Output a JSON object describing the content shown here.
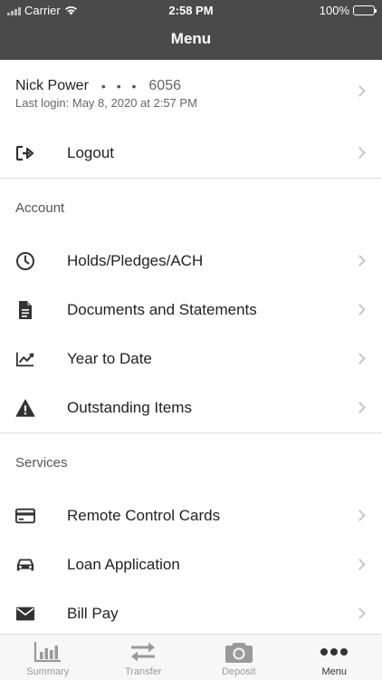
{
  "status_bar": {
    "carrier": "Carrier",
    "time": "2:58 PM",
    "battery": "100%"
  },
  "nav": {
    "title": "Menu"
  },
  "profile": {
    "name": "Nick Power",
    "dots": "• • •",
    "account_suffix": "6056",
    "last_login": "Last login: May 8, 2020 at 2:57 PM"
  },
  "logout": {
    "label": "Logout",
    "icon": "logout-icon"
  },
  "sections": {
    "account": {
      "header": "Account",
      "items": [
        {
          "label": "Holds/Pledges/ACH",
          "icon": "clock-icon"
        },
        {
          "label": "Documents and Statements",
          "icon": "document-icon"
        },
        {
          "label": "Year to Date",
          "icon": "trend-chart-icon"
        },
        {
          "label": "Outstanding Items",
          "icon": "warning-icon"
        }
      ]
    },
    "services": {
      "header": "Services",
      "items": [
        {
          "label": "Remote Control Cards",
          "icon": "credit-card-icon"
        },
        {
          "label": "Loan Application",
          "icon": "car-icon"
        },
        {
          "label": "Bill Pay",
          "icon": "envelope-icon"
        }
      ]
    }
  },
  "tabs": [
    {
      "label": "Summary",
      "icon": "bar-chart-icon",
      "active": false
    },
    {
      "label": "Transfer",
      "icon": "transfer-arrows-icon",
      "active": false
    },
    {
      "label": "Deposit",
      "icon": "camera-icon",
      "active": false
    },
    {
      "label": "Menu",
      "icon": "more-dots-icon",
      "active": true
    }
  ],
  "colors": {
    "header_bg": "#4a4a4a",
    "icon": "#333333",
    "chevron": "#c7c7c7",
    "tab_inactive": "#9a9a9a",
    "tab_active": "#333333"
  }
}
